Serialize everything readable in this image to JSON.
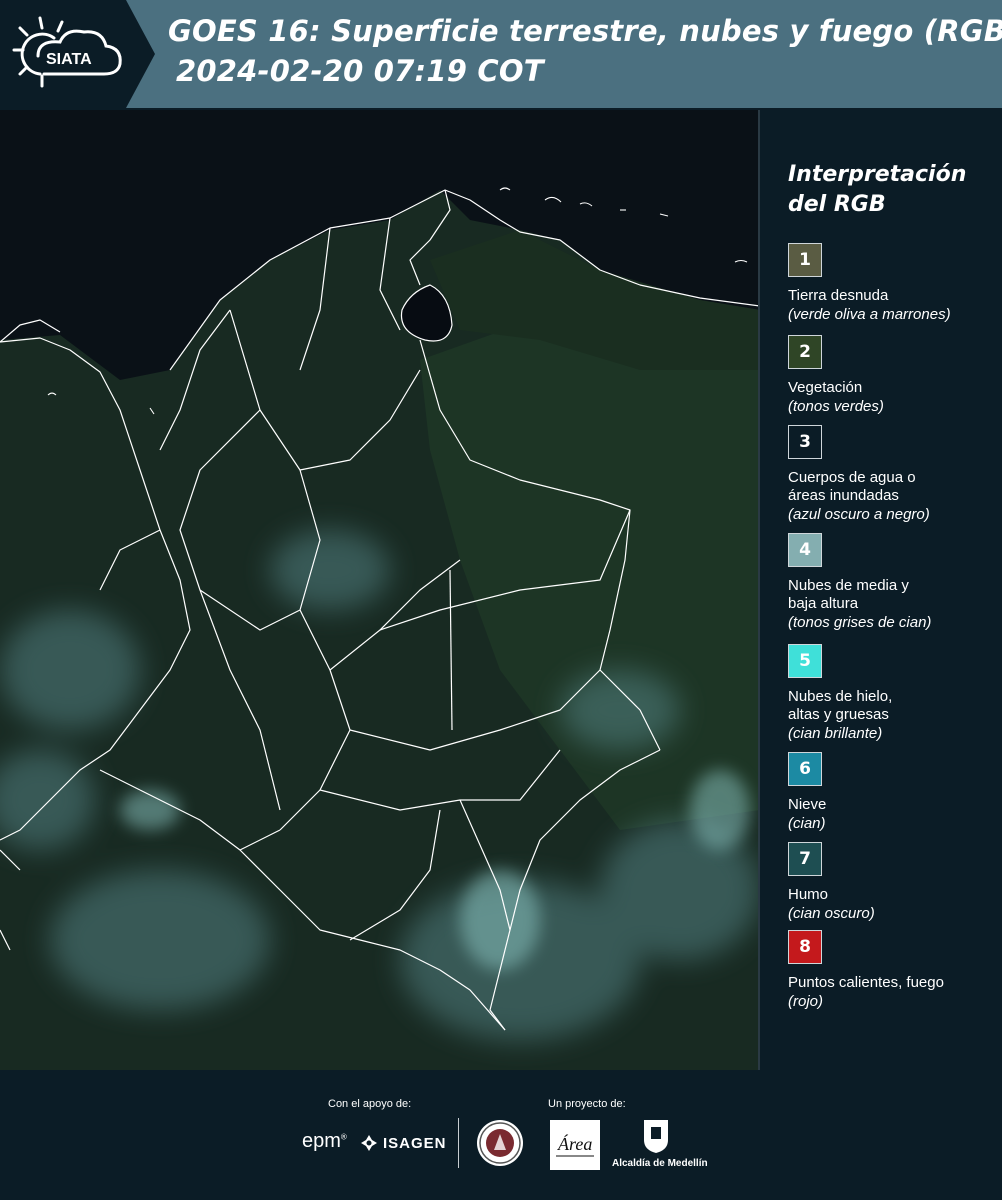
{
  "header": {
    "logo_text": "SIATA",
    "title_line1": "GOES 16: Superficie terrestre, nubes y fuego (RGB)",
    "title_line2": "2024-02-20 07:19 COT"
  },
  "map": {
    "icon": "satellite-rgb-composite-map",
    "land_color": "#17251c",
    "water_color": "#070c12",
    "cloud_color": "#6fa6a8",
    "border_color": "#ffffff"
  },
  "legend": {
    "title": "Interpretación del RGB",
    "items": [
      {
        "number": "1",
        "label": "Tierra desnuda",
        "desc": "(verde oliva a marrones)",
        "color": "#5a5c43"
      },
      {
        "number": "2",
        "label": "Vegetación",
        "desc": "(tonos verdes)",
        "color": "#2f4526"
      },
      {
        "number": "3",
        "label": "Cuerpos de agua o áreas inundadas",
        "desc": "(azul oscuro a negro)",
        "color": "#0b1c26"
      },
      {
        "number": "4",
        "label": "Nubes de media y baja altura",
        "desc": "(tonos grises de cian)",
        "color": "#84aeb0"
      },
      {
        "number": "5",
        "label": "Nubes de hielo, altas y gruesas",
        "desc": "(cian brillante)",
        "color": "#3fe0d9"
      },
      {
        "number": "6",
        "label": "Nieve",
        "desc": "(cian)",
        "color": "#1c8aa3"
      },
      {
        "number": "7",
        "label": "Humo",
        "desc": "(cian oscuro)",
        "color": "#1e4e52"
      },
      {
        "number": "8",
        "label": "Puntos calientes, fuego",
        "desc": "(rojo)",
        "color": "#c4191c"
      }
    ]
  },
  "footer": {
    "support_label": "Con el apoyo de:",
    "project_label": "Un proyecto de:",
    "epm_text": "epm",
    "isagen_text": "ISAGEN",
    "area_text": "Área",
    "alcaldia_text": "Alcaldía de Medellín"
  }
}
